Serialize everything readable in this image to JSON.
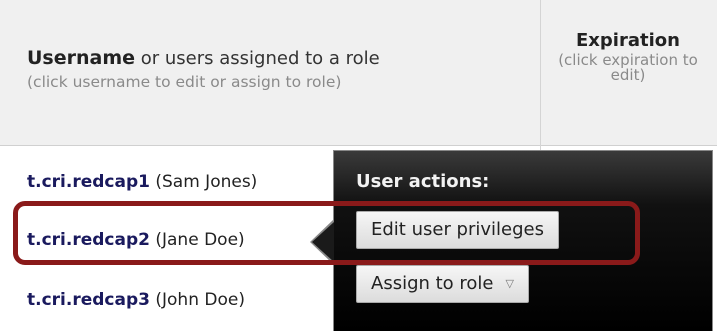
{
  "header": {
    "username_bold": "Username",
    "username_rest": " or users assigned to a role",
    "username_hint": "(click username to edit or assign to role)",
    "expiration_title": "Expiration",
    "expiration_hint": "(click expiration to edit)"
  },
  "users": [
    {
      "username": "t.cri.redcap1",
      "fullname": " (Sam Jones)"
    },
    {
      "username": "t.cri.redcap2",
      "fullname": " (Jane Doe)"
    },
    {
      "username": "t.cri.redcap3",
      "fullname": " (John Doe)"
    }
  ],
  "popup": {
    "title": "User actions:",
    "edit_label": "Edit user privileges",
    "assign_label": "Assign to role"
  },
  "icons": {
    "assign_caret": "chevron-down-icon"
  },
  "colors": {
    "highlight": "#8a1a1a",
    "username_link": "#1a1a5e"
  }
}
